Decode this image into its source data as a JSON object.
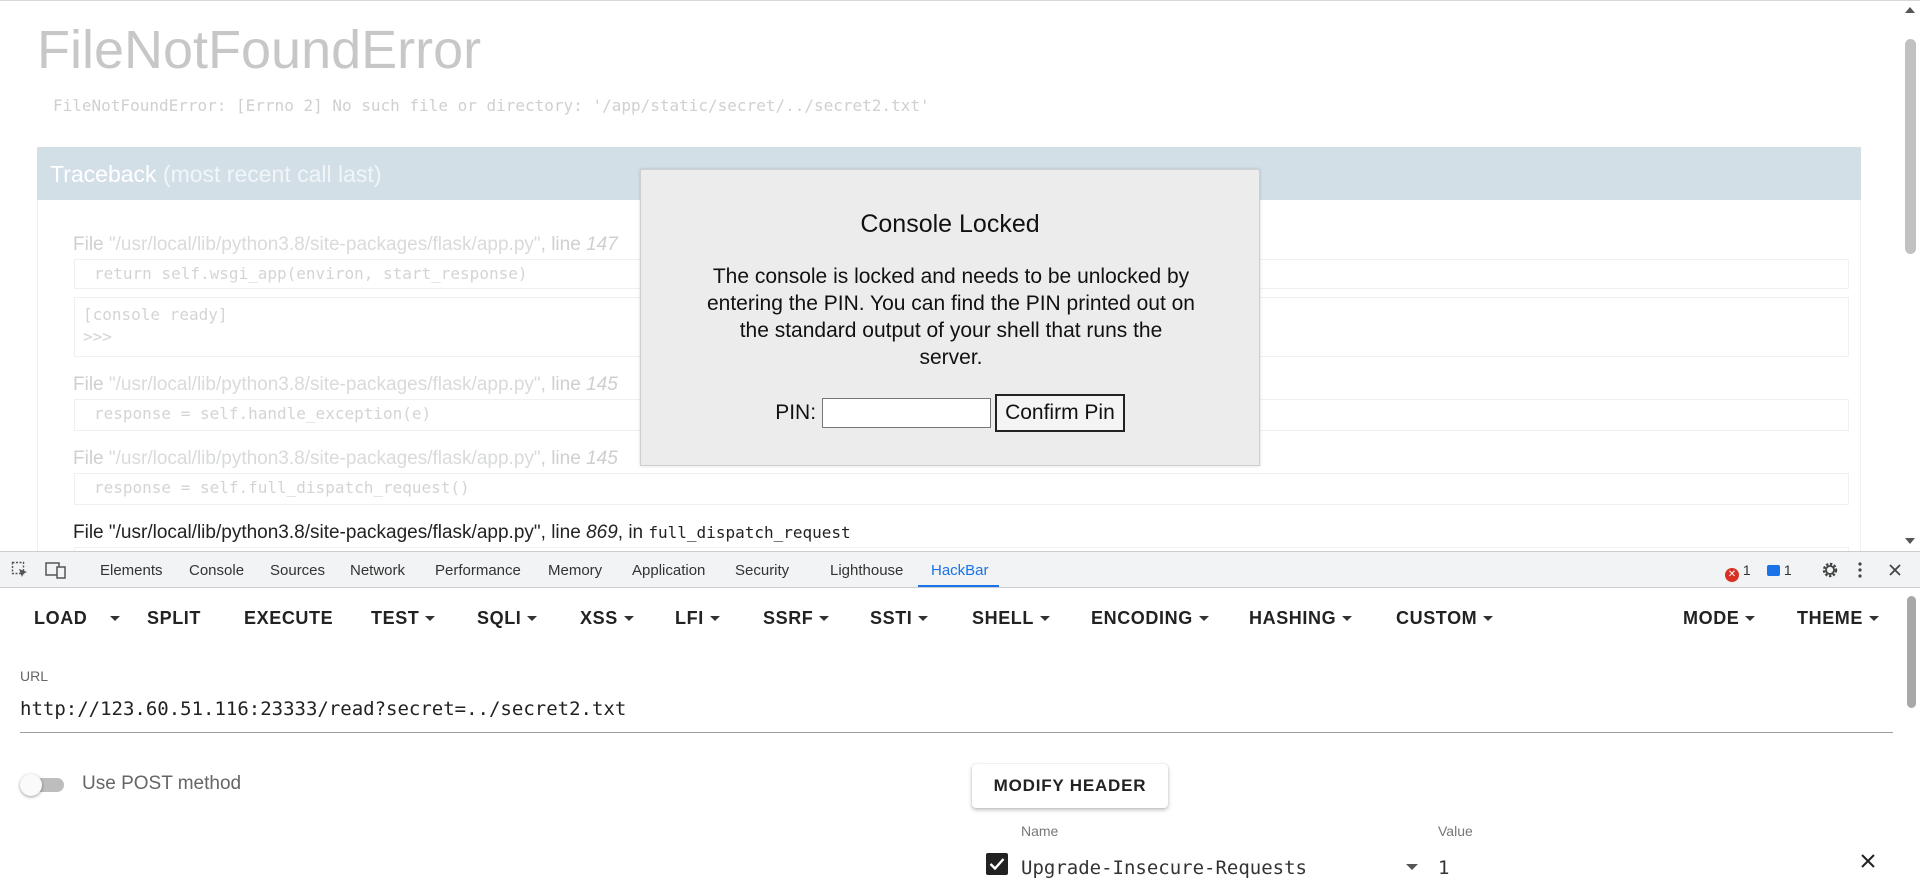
{
  "page": {
    "title": "FileNotFoundError",
    "error_message": "FileNotFoundError: [Errno 2] No such file or directory: '/app/static/secret/../secret2.txt'",
    "traceback_title": "Traceback",
    "traceback_subtitle": "(most recent call last)",
    "frames": [
      {
        "prefix": "File ",
        "path": "\"/usr/local/lib/python3.8/site-packages/flask/app.py\"",
        "sep": ", line ",
        "line": "147",
        "code": "return self.wsgi_app(environ, start_response)"
      },
      {
        "prefix": "File ",
        "path": "\"/usr/local/lib/python3.8/site-packages/flask/app.py\"",
        "sep": ", line ",
        "line": "145",
        "code": "response = self.handle_exception(e)"
      },
      {
        "prefix": "File ",
        "path": "\"/usr/local/lib/python3.8/site-packages/flask/app.py\"",
        "sep": ", line ",
        "line": "145",
        "code": "response = self.full_dispatch_request()"
      },
      {
        "prefix": "File ",
        "path": "\"/usr/local/lib/python3.8/site-packages/flask/app.py\"",
        "sep": ", line ",
        "line": "869",
        "in_text": ", in ",
        "func": "full_dispatch_request"
      }
    ],
    "console_lines": [
      "[console ready]",
      ">>>"
    ]
  },
  "lock_dialog": {
    "title": "Console Locked",
    "text": "The console is locked and needs to be unlocked by entering the PIN. You can find the PIN printed out on the standard output of your shell that runs the server.",
    "pin_label": "PIN:",
    "pin_value": "",
    "confirm_label": "Confirm Pin"
  },
  "devtools": {
    "tabs": [
      "Elements",
      "Console",
      "Sources",
      "Network",
      "Performance",
      "Memory",
      "Application",
      "Security",
      "Lighthouse",
      "HackBar"
    ],
    "active_tab": "HackBar",
    "error_count": "1",
    "message_count": "1"
  },
  "hackbar": {
    "toolbar": {
      "load": "LOAD",
      "split": "SPLIT",
      "execute": "EXECUTE",
      "test": "TEST",
      "sqli": "SQLI",
      "xss": "XSS",
      "lfi": "LFI",
      "ssrf": "SSRF",
      "ssti": "SSTI",
      "shell": "SHELL",
      "encoding": "ENCODING",
      "hashing": "HASHING",
      "custom": "CUSTOM",
      "mode": "MODE",
      "theme": "THEME"
    },
    "url_label": "URL",
    "url": "http://123.60.51.116:23333/read?secret=../secret2.txt",
    "post_label": "Use POST method",
    "post_enabled": false,
    "modify_header_label": "MODIFY HEADER",
    "header_name_label": "Name",
    "header_value_label": "Value",
    "headers": [
      {
        "enabled": true,
        "name": "Upgrade-Insecure-Requests",
        "value": "1"
      }
    ]
  },
  "colors": {
    "devtools_accent": "#1a73e8",
    "traceback_header_bg": "#d2dfe7",
    "error_badge": "#d93025"
  }
}
